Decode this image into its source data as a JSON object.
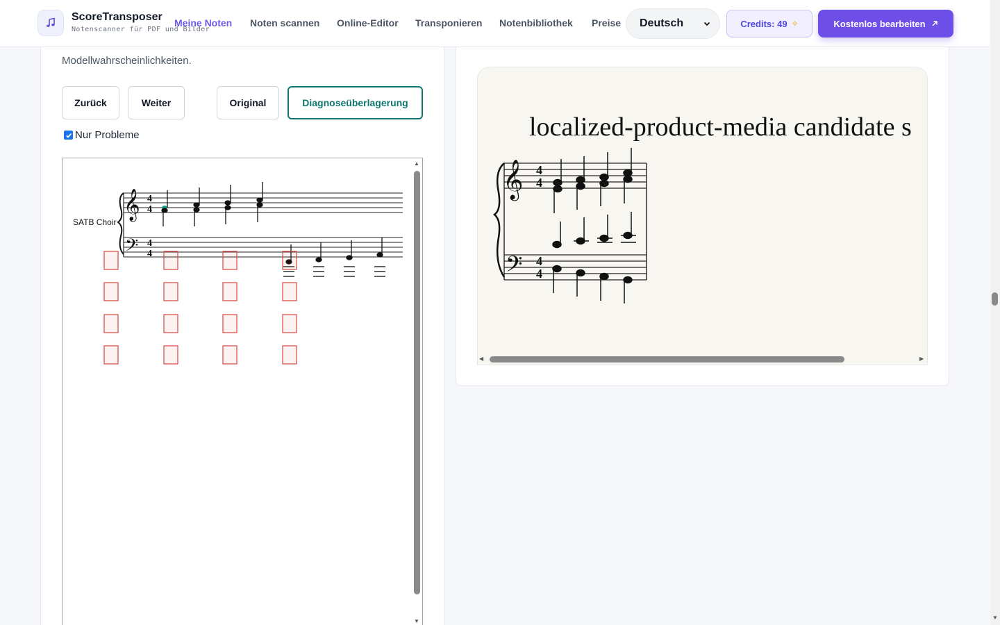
{
  "app": {
    "name": "ScoreTransposer",
    "tagline": "Notenscanner für PDF und Bilder"
  },
  "nav": [
    {
      "label": "Meine Noten",
      "active": true
    },
    {
      "label": "Noten scannen",
      "active": false
    },
    {
      "label": "Online-Editor",
      "active": false
    },
    {
      "label": "Transponieren",
      "active": false
    },
    {
      "label": "Notenbibliothek",
      "active": false
    },
    {
      "label": "Preise",
      "active": false
    }
  ],
  "language": {
    "selected": "Deutsch"
  },
  "credits": {
    "label": "Credits: 49"
  },
  "cta": {
    "label": "Kostenlos bearbeiten"
  },
  "diagnosis": {
    "hint": "Modellwahrscheinlichkeiten.",
    "buttons": {
      "back": "Zurück",
      "next": "Weiter",
      "original": "Original",
      "overlay": "Diagnoseüberlagerung"
    },
    "selected_view": "overlay",
    "only_problems": {
      "label": "Nur Probleme",
      "checked": true
    },
    "score": {
      "instrument_label": "SATB Choir",
      "time_signature": "4/4",
      "problem_box_rows": 4,
      "problem_box_columns": 4
    }
  },
  "preview": {
    "title": "localized-product-media candidate s",
    "time_signature": "4/4"
  },
  "colors": {
    "accent": "#6d4fe8",
    "nav_active": "#6d5ae6",
    "overlay_border": "#0f766e",
    "problem_box": "#d9534f",
    "highlight_note": "#14a085"
  },
  "icons": {
    "logo": "music-note-icon",
    "select": "chevron-down-icon",
    "credits": "sparkle-icon",
    "cta": "arrow-up-right-icon"
  }
}
